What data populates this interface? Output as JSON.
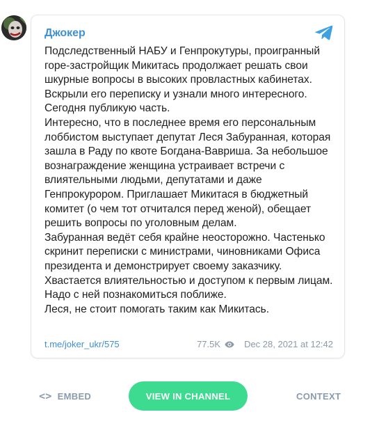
{
  "post": {
    "author": "Джокер",
    "message": "Подследственный НАБУ и Генпрокутуры, проигранный горе-застройщик Микитась продолжает решать свои шкурные вопросы в высоких провластных кабинетах. Вскрыли его переписку и узнали много интересного. Сегодня публикую часть.\nИнтересно, что в последнее время его персональным лоббистом выступает депутат Леся Забуранная, которая зашла в Раду по квоте Богдана-Вавриша. За небольшое вознаграждение женщина устраивает встречи с влиятельными людьми, депутатами и даже Генпрокурором. Приглашает Микитася в бюджетный комитет (о чем тот отчитался перед женой), обещает решить вопросы по уголовным делам.\nЗабуранная ведёт себя крайне неосторожно. Частенько скринит переписки с министрами, чиновниками Офиса президента и демонстрирует своему заказчику. Хвастается влиятельностью и доступом к первым лицам. Надо с ней познакомиться поближе.\nЛеся, не стоит помогать таким как Микитась.",
    "link": "t.me/joker_ukr/575",
    "views": "77.5K",
    "date": "Dec 28, 2021 at 12:42"
  },
  "actions": {
    "embed_label": "EMBED",
    "view_label": "VIEW IN CHANNEL",
    "context_label": "CONTEXT"
  },
  "icons": {
    "avatar": "joker-avatar",
    "brand": "telegram-icon",
    "views": "eye-icon",
    "embed": "code-brackets-icon"
  },
  "colors": {
    "accent": "#3f8fd2",
    "button": "#3ddb8f",
    "muted": "#8a9bad",
    "text": "#1f1f1f"
  }
}
